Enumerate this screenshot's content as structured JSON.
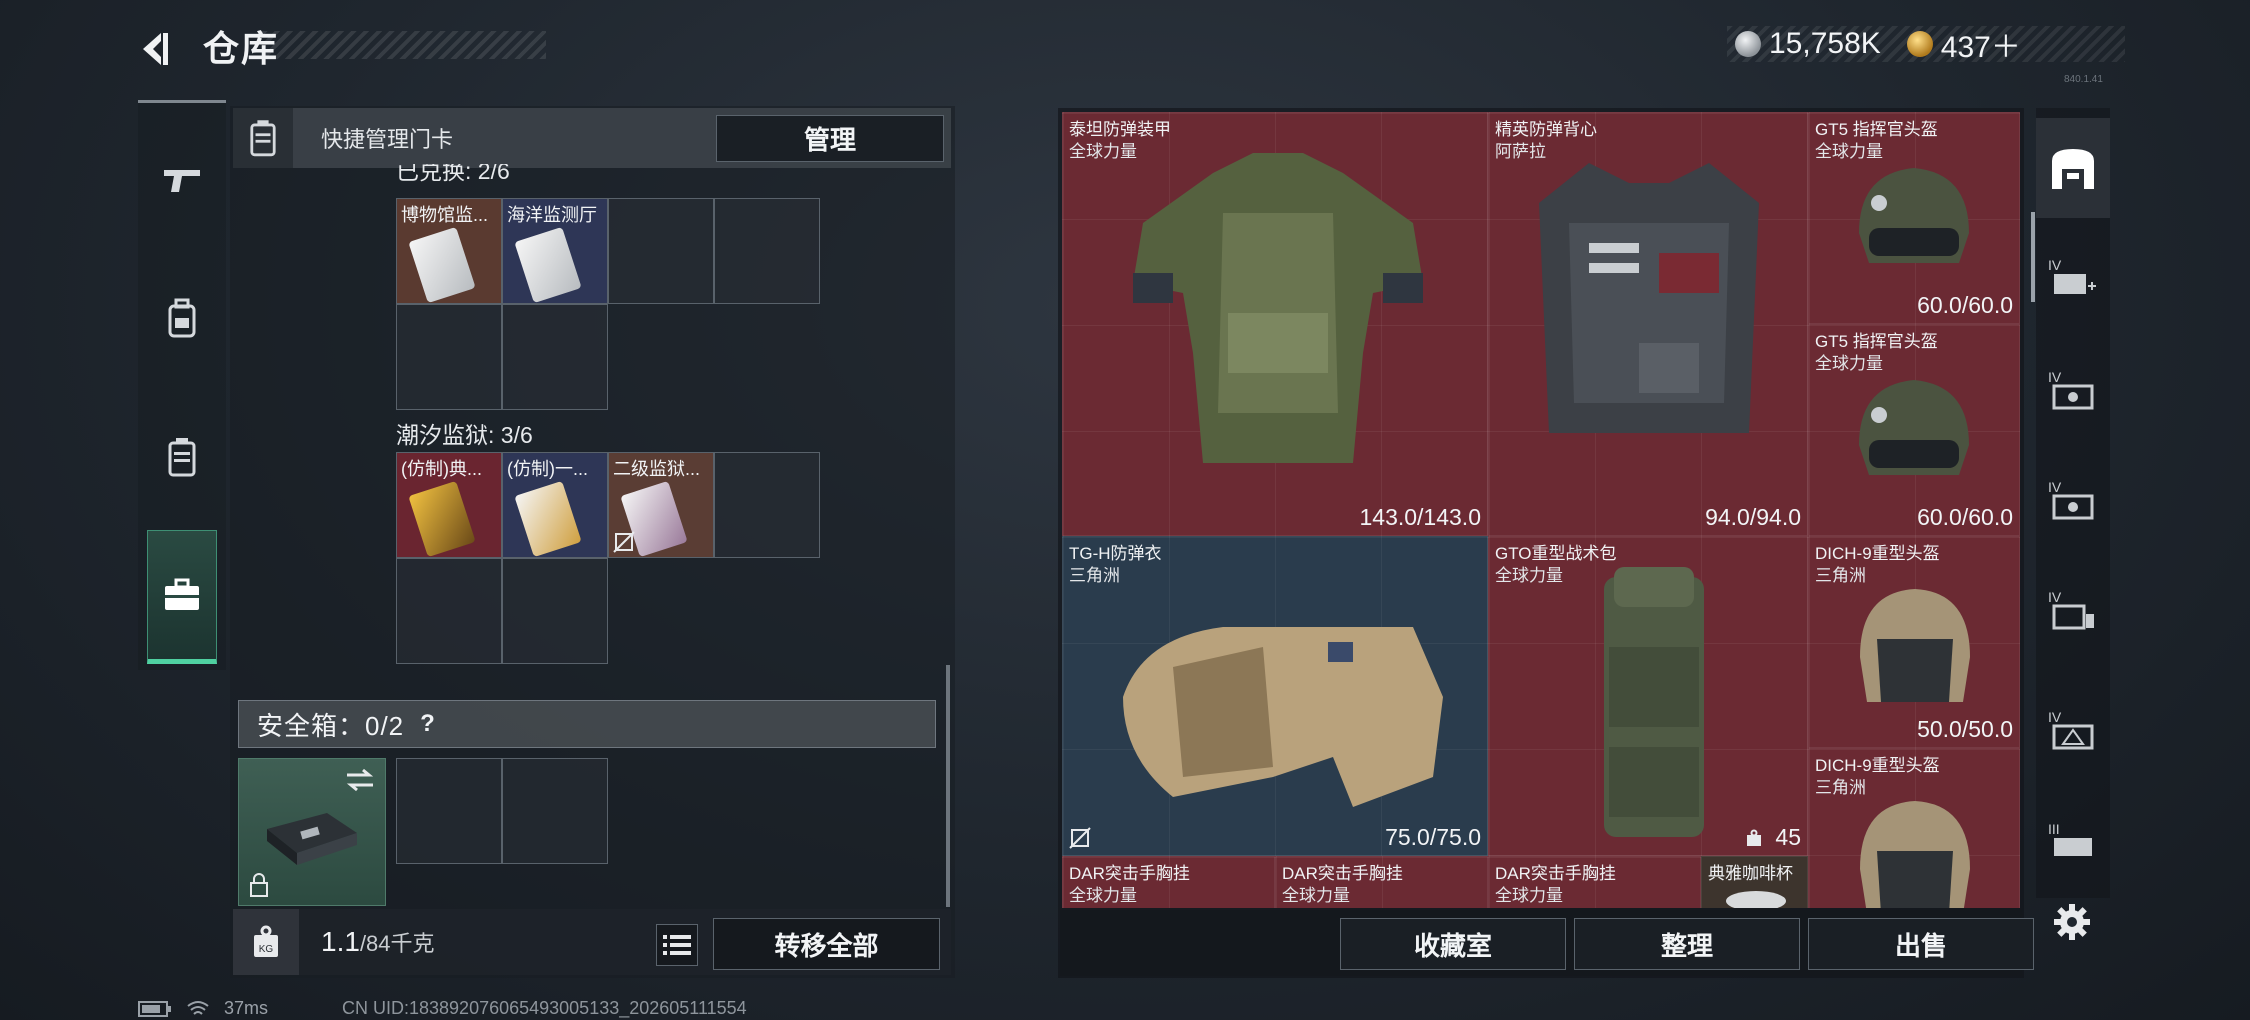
{
  "header": {
    "title": "仓库",
    "silver_amount": "15,758K",
    "gold_amount": "437＋",
    "version": "840.1.41"
  },
  "left_nav": {
    "items": [
      {
        "icon": "pistol-icon"
      },
      {
        "icon": "backpack-icon"
      },
      {
        "icon": "keycard-bag-icon"
      },
      {
        "icon": "briefcase-icon",
        "active": true
      }
    ]
  },
  "left_panel": {
    "header_text": "快捷管理门卡",
    "manage_label": "管理",
    "group1_label": "已兑换: 2/6",
    "group1_cards": [
      {
        "label": "博物馆监...",
        "color": "#8a4a3a"
      },
      {
        "label": "海洋监测厅",
        "color": "#3e4a78"
      }
    ],
    "group2_label": "潮汐监狱: 3/6",
    "group2_cards": [
      {
        "label": "(仿制)典...",
        "color": "#7a2a33"
      },
      {
        "label": "(仿制)一...",
        "color": "#3e4a78"
      },
      {
        "label": "二级监狱...",
        "color": "#5a3d34"
      }
    ],
    "safe_label": "安全箱：0/2",
    "help": "?",
    "weight": "1.1",
    "weight_max": "/84千克",
    "transfer_all": "转移全部"
  },
  "items": [
    {
      "name": "泰坦防弹装甲",
      "source": "全球力量",
      "durability": "143.0/143.0",
      "color": "red"
    },
    {
      "name": "精英防弹背心",
      "source": "阿萨拉",
      "durability": "94.0/94.0",
      "color": "red"
    },
    {
      "name": "GT5 指挥官头盔",
      "source": "全球力量",
      "durability": "60.0/60.0",
      "color": "red"
    },
    {
      "name": "GT5 指挥官头盔",
      "source": "全球力量",
      "durability": "60.0/60.0",
      "color": "red"
    },
    {
      "name": "TG-H防弹衣",
      "source": "三角洲",
      "durability": "75.0/75.0",
      "color": "blue"
    },
    {
      "name": "GTO重型战术包",
      "source": "全球力量",
      "durability": "45",
      "color": "red"
    },
    {
      "name": "DICH-9重型头盔",
      "source": "三角洲",
      "durability": "50.0/50.0",
      "color": "red"
    },
    {
      "name": "DICH-9重型头盔",
      "source": "三角洲",
      "durability": "",
      "color": "red"
    },
    {
      "name": "DAR突击手胸挂",
      "source": "全球力量",
      "durability": "",
      "color": "red"
    },
    {
      "name": "DAR突击手胸挂",
      "source": "全球力量",
      "durability": "",
      "color": "red"
    },
    {
      "name": "DAR突击手胸挂",
      "source": "全球力量",
      "durability": "",
      "color": "red"
    },
    {
      "name": "典雅咖啡杯",
      "source": "",
      "durability": "",
      "color": "brown"
    }
  ],
  "bottom_buttons": {
    "collection": "收藏室",
    "sort": "整理",
    "sell": "出售"
  },
  "status": {
    "ping": "37ms",
    "uid": "CN UID:183892076065493005133_202605111554"
  }
}
